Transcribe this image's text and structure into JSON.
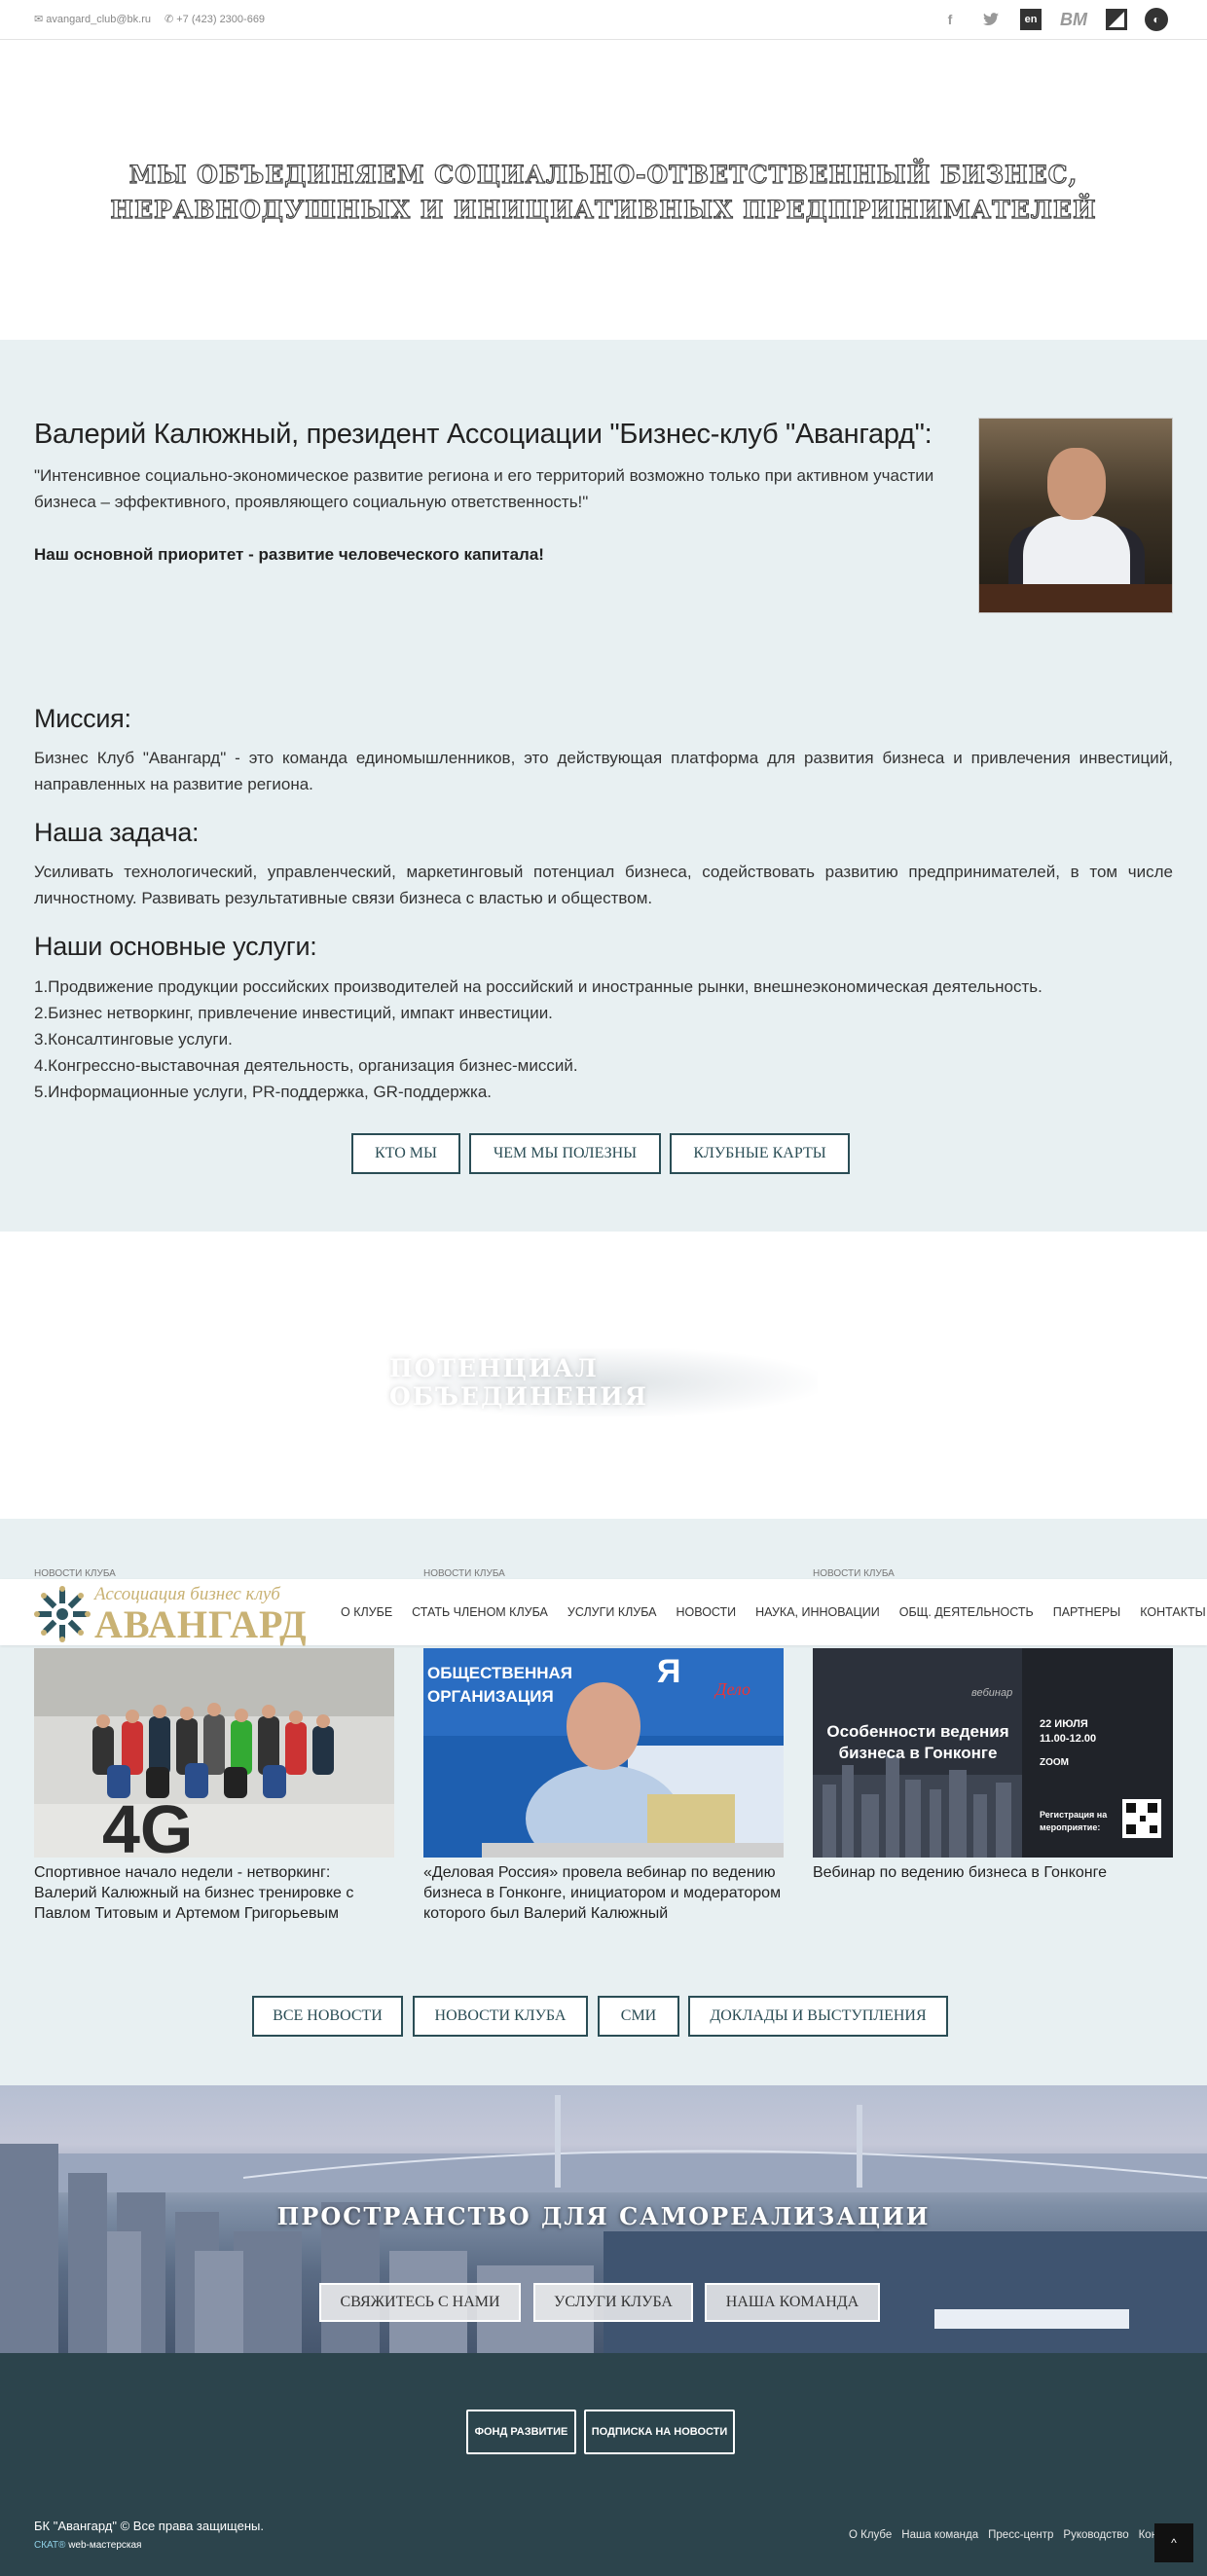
{
  "topbar": {
    "email": "avangard_club@bk.ru",
    "phone": "+7 (423) 2300-669",
    "social": [
      "facebook-icon",
      "twitter-icon",
      "en-icon",
      "bm-icon",
      "z-icon",
      "globe-icon"
    ],
    "social_labels": {
      "en": "en",
      "bm": "BM"
    }
  },
  "hero": {
    "title": "МЫ ОБЪЕДИНЯЕМ СОЦИАЛЬНО-ОТВЕТСТВЕННЫЙ БИЗНЕС, НЕРАВНОДУШНЫХ И ИНИЦИАТИВНЫХ ПРЕДПРИНИМАТЕЛЕЙ"
  },
  "president": {
    "title": "Валерий Калюжный, президент Ассоциации \"Бизнес-клуб \"Авангард\":",
    "quote": "\"Интенсивное социально-экономическое развитие региона и его территорий возможно только при активном участии бизнеса – эффективного, проявляющего социальную ответственность!\"",
    "priority": "Наш основной приоритет - развитие человеческого капитала!"
  },
  "mission": {
    "title": "Миссия:",
    "text": "Бизнес Клуб \"Авангард\" - это команда единомышленников, это действующая платформа для развития бизнеса и привлечения инвестиций, направленных на развитие региона."
  },
  "task": {
    "title": "Наша задача:",
    "text": "Усиливать технологический, управленческий, маркетинговый потенциал бизнеса, содействовать развитию предпринимателей, в том числе личностному. Развивать результативные связи бизнеса с властью и обществом."
  },
  "services": {
    "title": "Наши основные услуги:",
    "items": [
      "1.Продвижение продукции российских производителей на российский и иностранные рынки, внешнеэкономическая деятельность.",
      "2.Бизнес нетворкинг, привлечение инвестиций, импакт инвестиции.",
      "3.Консалтинговые услуги.",
      "4.Конгрессно-выставочная деятельность, организация бизнес-миссий.",
      "5.Информационные услуги, PR-поддержка, GR-поддержка."
    ]
  },
  "about_buttons": [
    "КТО МЫ",
    "ЧЕМ МЫ ПОЛЕЗНЫ",
    "КЛУБНЫЕ КАРТЫ"
  ],
  "potential": {
    "title": "ПОТЕНЦИАЛ ОБЪЕДИНЕНИЯ"
  },
  "nav": {
    "logo_sub": "Ассоциация бизнес клуб",
    "logo_main": "АВАНГАРД",
    "items": [
      "О КЛУБЕ",
      "СТАТЬ ЧЛЕНОМ КЛУБА",
      "УСЛУГИ КЛУБА",
      "НОВОСТИ",
      "НАУКА, ИННОВАЦИИ",
      "ОБЩ. ДЕЯТЕЛЬНОСТЬ",
      "ПАРТНЕРЫ",
      "КОНТАКТЫ"
    ]
  },
  "news": [
    {
      "tag": "НОВОСТИ КЛУБА",
      "title": "Спортивное начало недели - нетворкинг: Валерий Калюжный на бизнес тренировке с Павлом Титовым и Артемом Григорьевым"
    },
    {
      "tag": "НОВОСТИ КЛУБА",
      "title": "«Деловая Россия» провела вебинар по ведению бизнеса в Гонконге, инициатором и модератором которого был Валерий Калюжный",
      "banner": "ОБЩЕСТВЕННАЯ ОРГАНИЗАЦИЯ"
    },
    {
      "tag": "НОВОСТИ КЛУБА",
      "title": "Вебинар по ведению бизнеса в Гонконге",
      "poster": {
        "label": "вебинар",
        "headline": "Особенности ведения бизнеса в Гонконге",
        "date": "22 ИЮЛЯ",
        "time": "11.00-12.00",
        "platform": "ZOOM",
        "reg": "Регистрация на мероприятие:"
      }
    }
  ],
  "news_buttons": [
    "ВСЕ НОВОСТИ",
    "НОВОСТИ КЛУБА",
    "СМИ",
    "ДОКЛАДЫ И ВЫСТУПЛЕНИЯ"
  ],
  "city": {
    "title": "ПРОСТРАНСТВО ДЛЯ САМОРЕАЛИЗАЦИИ",
    "buttons": [
      "СВЯЖИТЕСЬ С НАМИ",
      "УСЛУГИ КЛУБА",
      "НАША КОМАНДА"
    ]
  },
  "footer": {
    "buttons": [
      "ФОНД РАЗВИТИЕ",
      "ПОДПИСКА НА НОВОСТИ"
    ],
    "copyright": "БК \"Авангард\" © Все права защищены.",
    "madeby_brand": "СКАТ®",
    "madeby_text": " web-мастерская",
    "links": [
      "О Клубе",
      "Наша команда",
      "Пресс-центр",
      "Руководство",
      "Контакты"
    ],
    "totop": "^"
  },
  "colors": {
    "accent": "#2a4d55",
    "logo_gold": "#c9b274",
    "light_bg": "#e8f0f2",
    "footer_bg": "#2c444c"
  }
}
